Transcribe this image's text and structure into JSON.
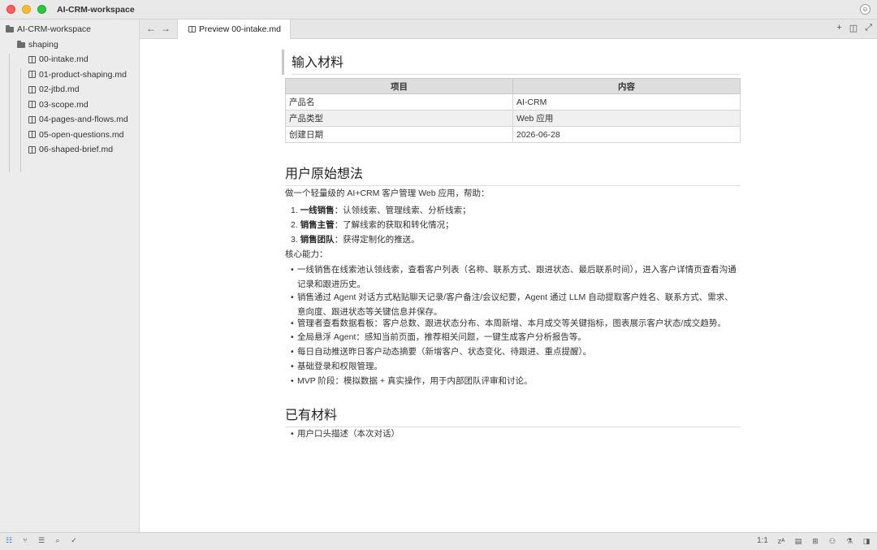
{
  "window": {
    "title": "AI-CRM-workspace",
    "avatar_icon": "user-avatar-icon"
  },
  "sidebar": {
    "root": "AI-CRM-workspace",
    "folder": "shaping",
    "files": [
      "00-intake.md",
      "01-product-shaping.md",
      "02-jtbd.md",
      "03-scope.md",
      "04-pages-and-flows.md",
      "05-open-questions.md",
      "06-shaped-brief.md"
    ]
  },
  "tabbar": {
    "back_icon": "←",
    "forward_icon": "→",
    "active_tab": "Preview 00-intake.md",
    "actions": [
      "+",
      "◫",
      "⤢"
    ]
  },
  "document": {
    "section1": {
      "heading": "输入材料",
      "table": {
        "headers": [
          "项目",
          "内容"
        ],
        "rows": [
          [
            "产品名",
            "AI-CRM"
          ],
          [
            "产品类型",
            "Web 应用"
          ],
          [
            "创建日期",
            "2026-06-28"
          ]
        ]
      }
    },
    "section2": {
      "heading": "用户原始想法",
      "intro": "做一个轻量级的 AI+CRM 客户管理 Web 应用，帮助：",
      "ordered": [
        {
          "num": "1.",
          "bold": "一线销售",
          "text": "：认领线索、管理线索、分析线索；"
        },
        {
          "num": "2.",
          "bold": "销售主管",
          "text": "：了解线索的获取和转化情况；"
        },
        {
          "num": "3.",
          "bold": "销售团队",
          "text": "：获得定制化的推送。"
        }
      ],
      "core_label": "核心能力：",
      "bullets": [
        "一线销售在线索池认领线索，查看客户列表（名称、联系方式、跟进状态、最后联系时间），进入客户详情页查看沟通记录和跟进历史。",
        "销售通过 Agent 对话方式粘贴聊天记录/客户备注/会议纪要，Agent 通过 LLM 自动提取客户姓名、联系方式、需求、意向度、跟进状态等关键信息并保存。",
        "管理者查看数据看板：客户总数、跟进状态分布、本周新增、本月成交等关键指标，图表展示客户状态/成交趋势。",
        "全局悬浮 Agent：感知当前页面，推荐相关问题，一键生成客户分析报告等。",
        "每日自动推送昨日客户动态摘要（新增客户、状态变化、待跟进、重点提醒）。",
        "基础登录和权限管理。",
        "MVP 阶段：模拟数据 + 真实操作，用于内部团队评审和讨论。"
      ]
    },
    "section3": {
      "heading": "已有材料",
      "bullets": [
        "用户口头描述（本次对话）"
      ]
    }
  },
  "statusbar": {
    "left_icons": [
      "☷",
      "⑂",
      "☰",
      "⌕",
      "✓"
    ],
    "zoom": "1:1",
    "right_icons": [
      "zᴬ",
      "▤",
      "⊞",
      "⚇",
      "⚗",
      "◨"
    ]
  }
}
